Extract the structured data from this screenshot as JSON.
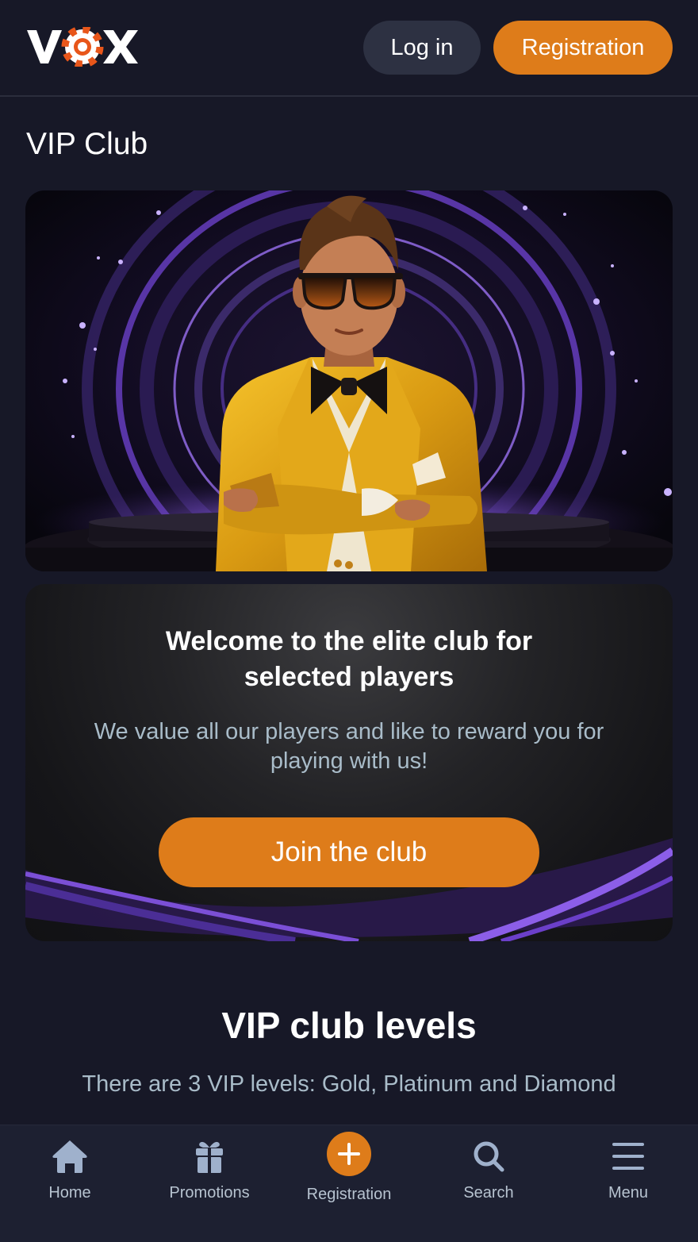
{
  "header": {
    "logo_text": "VOX",
    "login_label": "Log in",
    "register_label": "Registration"
  },
  "page": {
    "title": "VIP Club"
  },
  "welcome": {
    "title_line1": "Welcome to the elite club for",
    "title_line2": "selected players",
    "subtitle": "We value all our players and like to reward you for playing with us!",
    "join_label": "Join the club"
  },
  "levels": {
    "title": "VIP club levels",
    "subtitle": "There are 3 VIP levels: Gold, Platinum and Diamond"
  },
  "bottom_nav": {
    "items": [
      {
        "label": "Home",
        "icon": "home-icon"
      },
      {
        "label": "Promotions",
        "icon": "gift-icon"
      },
      {
        "label": "Registration",
        "icon": "plus-icon"
      },
      {
        "label": "Search",
        "icon": "search-icon"
      },
      {
        "label": "Menu",
        "icon": "menu-icon"
      }
    ]
  },
  "colors": {
    "background": "#171827",
    "accent": "#de7c1a",
    "secondary_button": "#2d3142",
    "muted_text": "#a9bcc9",
    "purple_glow": "#7b4fd6"
  }
}
